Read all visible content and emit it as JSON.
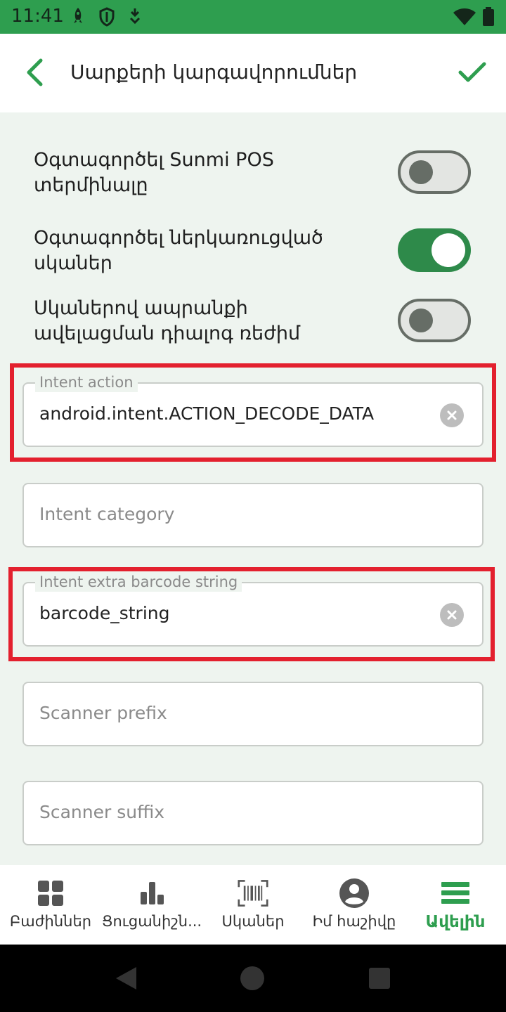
{
  "status_bar": {
    "time": "11:41",
    "icons": [
      "rocket-icon",
      "shield-icon",
      "download-icon",
      "wifi-icon",
      "battery-icon"
    ]
  },
  "app_bar": {
    "title": "Սարքերի կարգավորումներ",
    "back_icon": "chevron-left-icon",
    "confirm_icon": "checkmark-icon"
  },
  "colors": {
    "primary": "#2e9e4f",
    "switch_on": "#2e8a4a",
    "highlight": "#e3202e",
    "background": "#eef4ef"
  },
  "toggles": [
    {
      "label": "Օգտագործել Sunmi POS տերմինալը",
      "on": false
    },
    {
      "label": "Օգտագործել ներկառուցված սկաներ",
      "on": true
    },
    {
      "label": "Սկաներով ապրանքի ավելացման դիալոգ ռեժիմ",
      "on": false
    }
  ],
  "fields": {
    "intent_action": {
      "label": "Intent action",
      "value": "android.intent.ACTION_DECODE_DATA"
    },
    "intent_category": {
      "placeholder": "Intent category"
    },
    "intent_extra": {
      "label": "Intent extra barcode string",
      "value": "barcode_string"
    },
    "scanner_prefix": {
      "placeholder": "Scanner prefix"
    },
    "scanner_suffix": {
      "placeholder": "Scanner suffix"
    }
  },
  "bottom_nav": [
    {
      "label": "Բաժիններ",
      "icon": "grid-icon",
      "active": false
    },
    {
      "label": "Ցուցանիշն...",
      "icon": "bar-chart-icon",
      "active": false
    },
    {
      "label": "Սկաներ",
      "icon": "barcode-scan-icon",
      "active": false
    },
    {
      "label": "Իմ հաշիվը",
      "icon": "account-icon",
      "active": false
    },
    {
      "label": "Ավելին",
      "icon": "menu-icon",
      "active": true
    }
  ]
}
